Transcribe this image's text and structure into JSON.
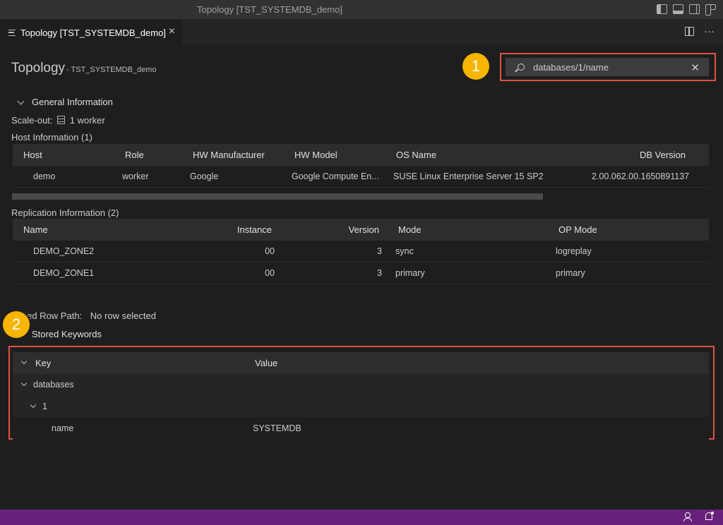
{
  "window": {
    "title": "Topology [TST_SYSTEMDB_demo]"
  },
  "tab": {
    "label": "Topology [TST_SYSTEMDB_demo]",
    "close": "×"
  },
  "tab_actions": {
    "more": "···"
  },
  "header": {
    "title": "Topology",
    "subtitle": "- TST_SYSTEMDB_demo"
  },
  "search": {
    "value": "databases/1/name",
    "clear": "✕"
  },
  "badges": {
    "one": "1",
    "two": "2"
  },
  "general": {
    "heading": "General Information",
    "scaleout_label": "Scale-out:",
    "scaleout_value": "1 worker"
  },
  "hosts": {
    "caption": "Host Information (1)",
    "columns": [
      "Host",
      "Role",
      "HW Manufacturer",
      "HW Model",
      "OS Name",
      "DB Version"
    ],
    "rows": [
      [
        "demo",
        "worker",
        "Google",
        "Google Compute En...",
        "SUSE Linux Enterprise Server 15 SP2",
        "2.00.062.00.1650891137"
      ]
    ]
  },
  "replication": {
    "caption": "Replication Information (2)",
    "columns": [
      "Name",
      "Instance",
      "Version",
      "Mode",
      "OP Mode"
    ],
    "rows": [
      [
        "DEMO_ZONE2",
        "00",
        "3",
        "sync",
        "logreplay"
      ],
      [
        "DEMO_ZONE1",
        "00",
        "3",
        "primary",
        "primary"
      ]
    ]
  },
  "selection": {
    "label": "cted Row Path:",
    "value": "No row selected"
  },
  "stored": {
    "heading": "Stored Keywords"
  },
  "keywords": {
    "col_key": "Key",
    "col_value": "Value",
    "rows": [
      {
        "key": "databases",
        "value": ""
      },
      {
        "key": "1",
        "value": ""
      },
      {
        "key": "name",
        "value": "SYSTEMDB"
      }
    ]
  },
  "colors": {
    "accent": "#68217a",
    "annotation": "#e0533f",
    "badge": "#f7b500"
  }
}
